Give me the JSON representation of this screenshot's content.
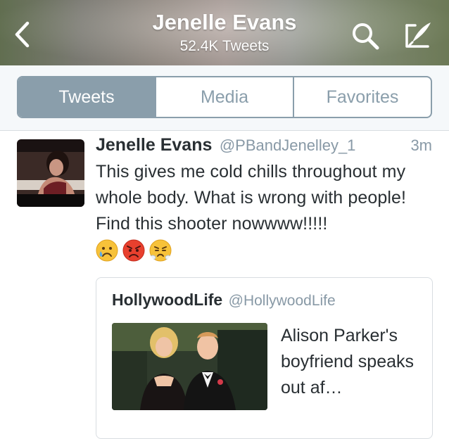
{
  "header": {
    "name": "Jenelle Evans",
    "tweet_count": "52.4K Tweets",
    "back_icon": "chevron-left-icon",
    "search_icon": "search-icon",
    "compose_icon": "compose-icon"
  },
  "tabs": [
    {
      "label": "Tweets",
      "active": true
    },
    {
      "label": "Media",
      "active": false
    },
    {
      "label": "Favorites",
      "active": false
    }
  ],
  "tweet": {
    "author_name": "Jenelle Evans",
    "author_handle": "@PBandJenelley_1",
    "time": "3m",
    "text": "This gives me cold chills throughout my whole body. What is wrong with people! Find this shooter nowwww!!!!!",
    "emojis": [
      "crying-face-icon",
      "angry-face-icon",
      "steaming-face-icon"
    ]
  },
  "quoted_tweet": {
    "author_name": "HollywoodLife",
    "author_handle": "@HollywoodLife",
    "headline": "Alison Parker's boyfriend speaks out af…"
  },
  "colors": {
    "segment_accent": "#8a9eab",
    "text_primary": "#292f33",
    "text_secondary": "#8899a6",
    "divider": "#d8dde1"
  }
}
